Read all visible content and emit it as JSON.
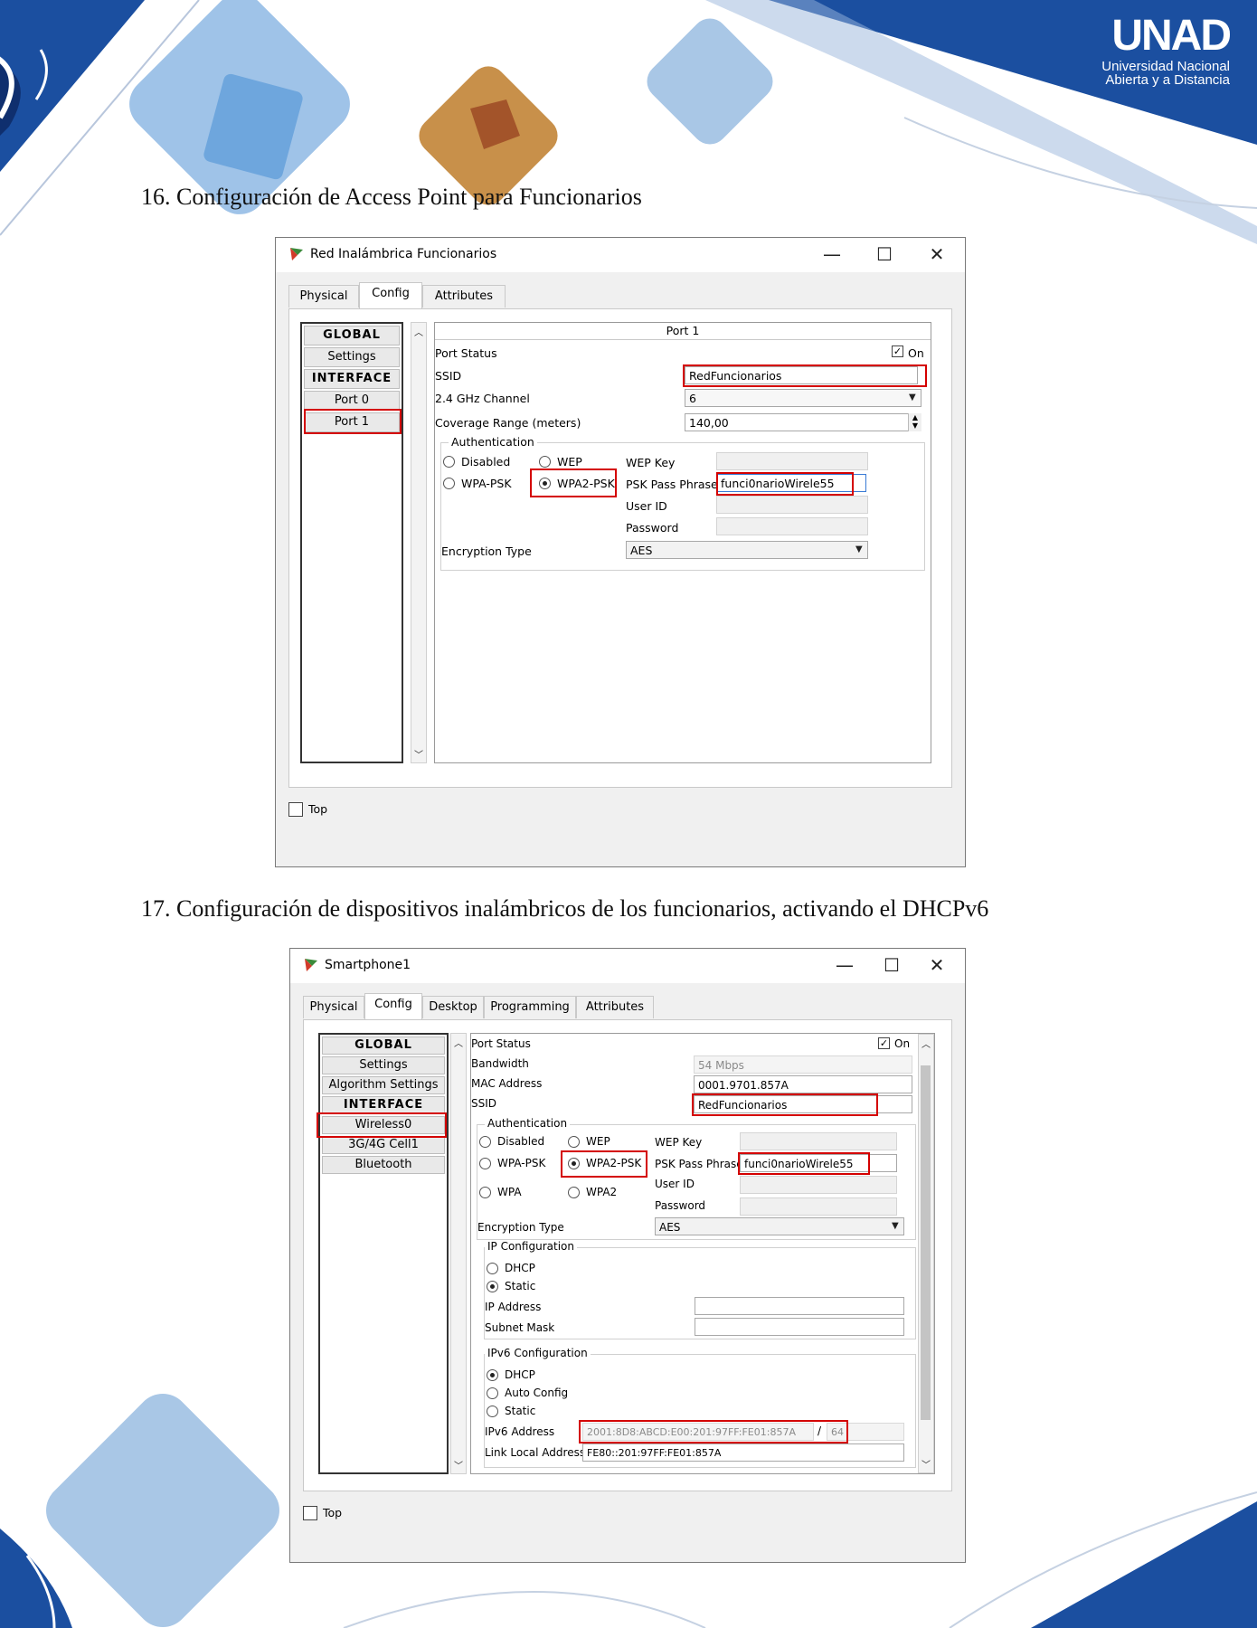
{
  "brand": {
    "logo_text": "UNAD",
    "logo_line1": "Universidad Nacional",
    "logo_line2": "Abierta y a Distancia"
  },
  "captions": {
    "step16": "16. Configuración de Access Point para Funcionarios",
    "step17": "17. Configuración de dispositivos inalámbricos de los funcionarios, activando el DHCPv6"
  },
  "win1": {
    "title": "Red Inalámbrica Funcionarios",
    "controls": {
      "minimize": "—",
      "maximize": "☐",
      "close": "✕"
    },
    "tabs": [
      "Physical",
      "Config",
      "Attributes"
    ],
    "active_tab": "Config",
    "sidebar": [
      "GLOBAL",
      "Settings",
      "INTERFACE",
      "Port 0",
      "Port 1"
    ],
    "selected_item": "Port 1",
    "panel_title": "Port 1",
    "port_status_label": "Port Status",
    "port_status_value": "On",
    "ssid_label": "SSID",
    "ssid_value": "RedFuncionarios",
    "channel_label": "2.4 GHz Channel",
    "channel_value": "6",
    "coverage_label": "Coverage Range (meters)",
    "coverage_value": "140,00",
    "auth_legend": "Authentication",
    "auth_options": {
      "disabled": "Disabled",
      "wep": "WEP",
      "wpa_psk": "WPA-PSK",
      "wpa2_psk": "WPA2-PSK"
    },
    "auth_selected": "WPA2-PSK",
    "wep_key_label": "WEP Key",
    "psk_label": "PSK Pass Phrase",
    "psk_value": "funci0narioWirele55",
    "userid_label": "User ID",
    "password_label": "Password",
    "encryption_label": "Encryption Type",
    "encryption_value": "AES",
    "top_label": "Top"
  },
  "win2": {
    "title": "Smartphone1",
    "controls": {
      "minimize": "—",
      "maximize": "☐",
      "close": "✕"
    },
    "tabs": [
      "Physical",
      "Config",
      "Desktop",
      "Programming",
      "Attributes"
    ],
    "active_tab": "Config",
    "sidebar": [
      "GLOBAL",
      "Settings",
      "Algorithm Settings",
      "INTERFACE",
      "Wireless0",
      "3G/4G Cell1",
      "Bluetooth"
    ],
    "selected_item": "Wireless0",
    "port_status_label": "Port Status",
    "port_status_value": "On",
    "bandwidth_label": "Bandwidth",
    "bandwidth_value": "54 Mbps",
    "mac_label": "MAC Address",
    "mac_value": "0001.9701.857A",
    "ssid_label": "SSID",
    "ssid_value": "RedFuncionarios",
    "auth_legend": "Authentication",
    "auth_options": {
      "disabled": "Disabled",
      "wep": "WEP",
      "wpa_psk": "WPA-PSK",
      "wpa2_psk": "WPA2-PSK",
      "wpa": "WPA",
      "wpa2": "WPA2"
    },
    "auth_selected": "WPA2-PSK",
    "wep_key_label": "WEP Key",
    "psk_label": "PSK Pass Phrase",
    "psk_value": "funci0narioWirele55",
    "userid_label": "User ID",
    "password_label": "Password",
    "encryption_label": "Encryption Type",
    "encryption_value": "AES",
    "ip_legend": "IP Configuration",
    "ip_options": {
      "dhcp": "DHCP",
      "static": "Static"
    },
    "ip_selected": "Static",
    "ip_address_label": "IP Address",
    "subnet_label": "Subnet Mask",
    "ipv6_legend": "IPv6 Configuration",
    "ipv6_options": {
      "dhcp": "DHCP",
      "auto": "Auto Config",
      "static": "Static"
    },
    "ipv6_selected": "DHCP",
    "ipv6_address_label": "IPv6 Address",
    "ipv6_address_value": "2001:8D8:ABCD:E00:201:97FF:FE01:857A",
    "ipv6_prefix_sep": "/",
    "ipv6_prefix_value": "64",
    "link_local_label": "Link Local Address:",
    "link_local_value": "FE80::201:97FF:FE01:857A",
    "top_label": "Top"
  },
  "colors": {
    "highlight": "#d40000",
    "brand_blue": "#1b4fa0"
  }
}
